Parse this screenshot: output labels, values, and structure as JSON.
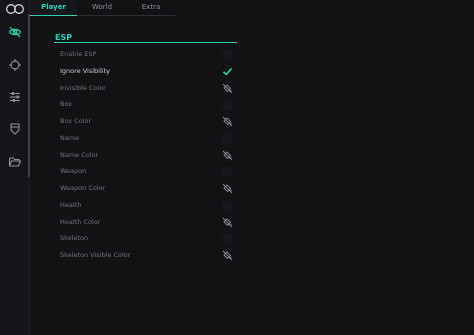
{
  "tabs": [
    {
      "label": "Player",
      "active": true
    },
    {
      "label": "World",
      "active": false
    },
    {
      "label": "Extra",
      "active": false
    }
  ],
  "sidebar_icons": [
    "eye-slash-icon",
    "crosshair-icon",
    "sliders-icon",
    "paint-bucket-icon",
    "folder-open-icon"
  ],
  "section": {
    "title": "ESP"
  },
  "options": [
    {
      "label": "Enable ESP",
      "control": "checkbox",
      "checked": false
    },
    {
      "label": "Ignore Visibility",
      "control": "checkbox",
      "checked": true
    },
    {
      "label": "Invisible Color",
      "control": "color"
    },
    {
      "label": "Box",
      "control": "checkbox",
      "checked": false
    },
    {
      "label": "Box Color",
      "control": "color"
    },
    {
      "label": "Name",
      "control": "checkbox",
      "checked": false
    },
    {
      "label": "Name Color",
      "control": "color"
    },
    {
      "label": "Weapon",
      "control": "checkbox",
      "checked": false
    },
    {
      "label": "Weapon Color",
      "control": "color"
    },
    {
      "label": "Health",
      "control": "checkbox",
      "checked": false
    },
    {
      "label": "Health Color",
      "control": "color"
    },
    {
      "label": "Skeleton",
      "control": "checkbox",
      "checked": false
    },
    {
      "label": "Skeleton Visible Color",
      "control": "color"
    }
  ],
  "colors": {
    "accent": "#2fd2b0",
    "background": "#121315",
    "sidebar": "#15161a",
    "text": "#6d7076",
    "text_active": "#c8cacf"
  }
}
